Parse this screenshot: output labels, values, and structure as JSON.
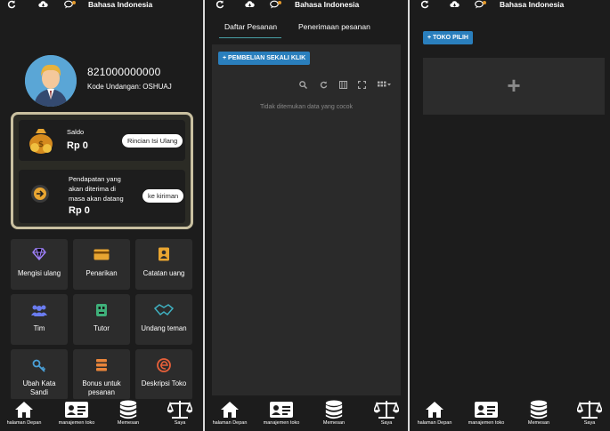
{
  "header": {
    "language": "Bahasa Indonesia"
  },
  "profile": {
    "phone": "821000000000",
    "invite_code": "Kode Undangan: OSHUAJ"
  },
  "balance_card": {
    "title": "Saldo",
    "amount": "Rp 0",
    "button": "Rincian Isi Ulang"
  },
  "income_card": {
    "line1": "Pendapatan yang",
    "line2": "akan diterima di",
    "line3": "masa akan datang",
    "amount": "Rp 0",
    "button": "ke kiriman"
  },
  "grid": [
    {
      "label": "Mengisi ulang",
      "icon": "diamond-icon"
    },
    {
      "label": "Penarikan",
      "icon": "card-icon"
    },
    {
      "label": "Catatan uang",
      "icon": "contact-book-icon"
    },
    {
      "label": "Tim",
      "icon": "team-icon"
    },
    {
      "label": "Tutor",
      "icon": "tutor-icon"
    },
    {
      "label": "Undang teman",
      "icon": "handshake-icon"
    },
    {
      "label": "Ubah Kata",
      "label2": "Sandi",
      "icon": "key-icon"
    },
    {
      "label": "Bonus untuk",
      "label2": "pesanan",
      "icon": "stack-icon"
    },
    {
      "label": "Deskripsi Toko",
      "icon": "edge-icon"
    }
  ],
  "nav": [
    {
      "label": "halaman Depan",
      "icon": "home-icon"
    },
    {
      "label": "manajemen toko",
      "icon": "id-card-icon"
    },
    {
      "label": "Memesan",
      "icon": "database-icon"
    },
    {
      "label": "Saya",
      "icon": "scale-icon"
    }
  ],
  "orders": {
    "tab_list": "Daftar Pesanan",
    "tab_receipt": "Penerimaan pesanan",
    "one_click_btn": "+ PEMBELIAN SEKALI KLIK",
    "empty": "Tidak ditemukan data yang cocok"
  },
  "store": {
    "pick_btn": "+ TOKO PILIH",
    "plus": "+"
  },
  "colors": {
    "accent_blue": "#2a7fbd",
    "gold_border": "#c9c0a0",
    "tab_line": "#48a0a6"
  }
}
